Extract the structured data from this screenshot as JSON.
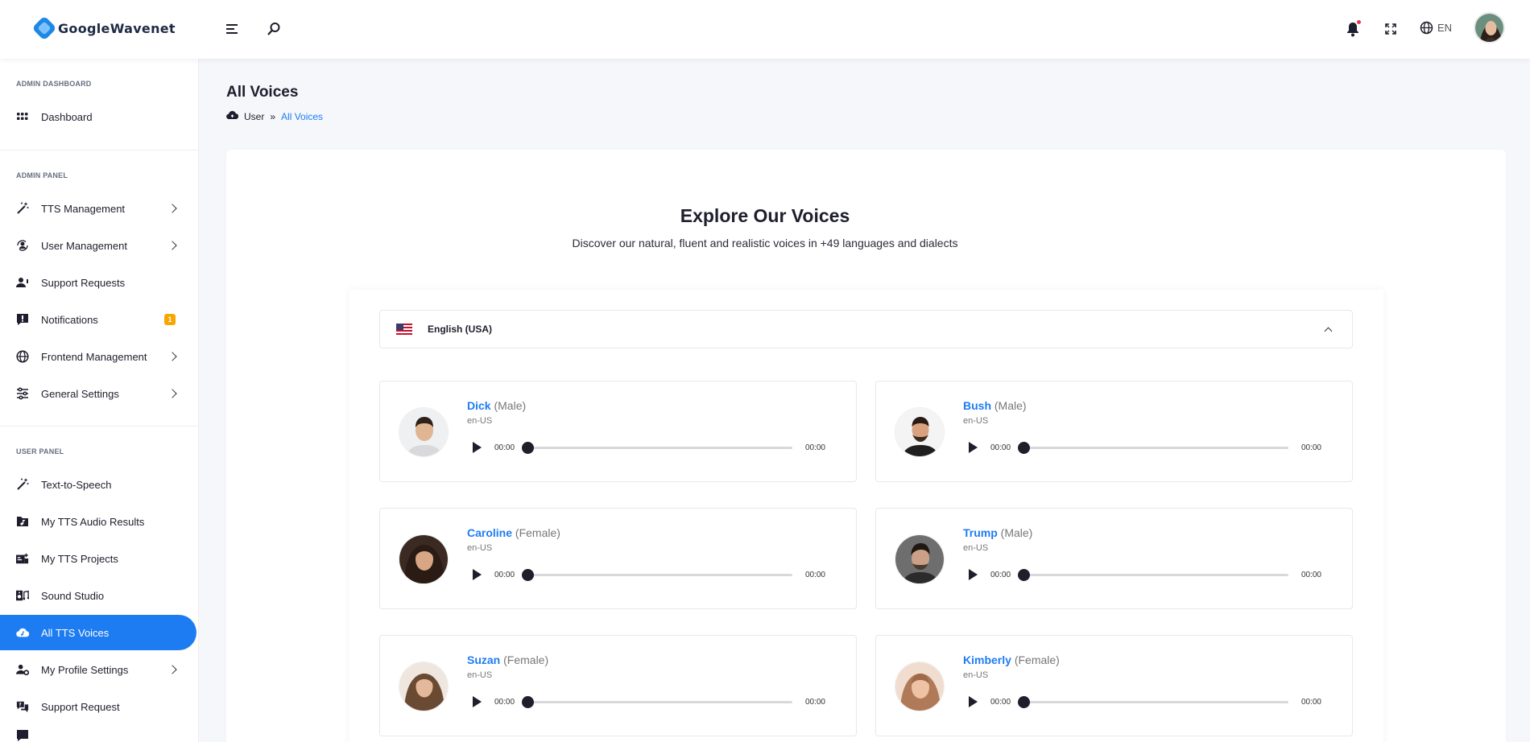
{
  "brand": {
    "name_first": "Google",
    "name_second": "Wavenet"
  },
  "topbar": {
    "language": "EN"
  },
  "sidebar": {
    "sections": {
      "admin_dashboard": "ADMIN DASHBOARD",
      "admin_panel": "ADMIN PANEL",
      "user_panel": "USER PANEL"
    },
    "items": [
      {
        "label": "Dashboard"
      },
      {
        "label": "TTS Management"
      },
      {
        "label": "User Management"
      },
      {
        "label": "Support Requests"
      },
      {
        "label": "Notifications",
        "badge": "1"
      },
      {
        "label": "Frontend Management"
      },
      {
        "label": "General Settings"
      },
      {
        "label": "Text-to-Speech"
      },
      {
        "label": "My TTS Audio Results"
      },
      {
        "label": "My TTS Projects"
      },
      {
        "label": "Sound Studio"
      },
      {
        "label": "All TTS Voices"
      },
      {
        "label": "My Profile Settings"
      },
      {
        "label": "Support Request"
      }
    ]
  },
  "page": {
    "title": "All Voices",
    "breadcrumb": [
      "User",
      "All Voices"
    ]
  },
  "explore": {
    "title": "Explore Our Voices",
    "subtitle": "Discover our natural, fluent and realistic voices in +49 languages and dialects"
  },
  "language_group": {
    "label": "English (USA)"
  },
  "voices": [
    {
      "name": "Dick",
      "gender": "(Male)",
      "lang": "en-US",
      "current": "00:00",
      "duration": "00:00"
    },
    {
      "name": "Bush",
      "gender": "(Male)",
      "lang": "en-US",
      "current": "00:00",
      "duration": "00:00"
    },
    {
      "name": "Caroline",
      "gender": "(Female)",
      "lang": "en-US",
      "current": "00:00",
      "duration": "00:00"
    },
    {
      "name": "Trump",
      "gender": "(Male)",
      "lang": "en-US",
      "current": "00:00",
      "duration": "00:00"
    },
    {
      "name": "Suzan",
      "gender": "(Female)",
      "lang": "en-US",
      "current": "00:00",
      "duration": "00:00"
    },
    {
      "name": "Kimberly",
      "gender": "(Female)",
      "lang": "en-US",
      "current": "00:00",
      "duration": "00:00"
    }
  ],
  "colors": {
    "accent": "#1e7cf2",
    "badge": "#f7a600",
    "notification_dot": "#e53950"
  }
}
